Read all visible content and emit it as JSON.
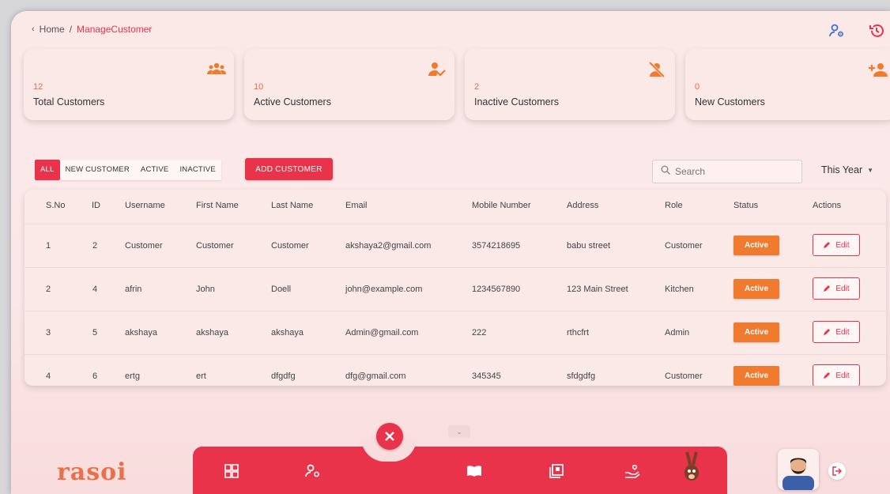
{
  "breadcrumb": {
    "back_icon": "chevron-left-icon",
    "home": "Home",
    "separator": "/",
    "current": "ManageCustomer"
  },
  "header_icons": [
    "user-settings-icon",
    "history-icon"
  ],
  "stats": [
    {
      "value": "12",
      "label": "Total Customers",
      "icon": "group-icon"
    },
    {
      "value": "10",
      "label": "Active Customers",
      "icon": "user-check-icon"
    },
    {
      "value": "2",
      "label": "Inactive Customers",
      "icon": "user-off-icon"
    },
    {
      "value": "0",
      "label": "New Customers",
      "icon": "user-add-icon"
    }
  ],
  "filters": {
    "all": "ALL",
    "new": "NEW CUSTOMER",
    "active": "ACTIVE",
    "inactive": "INACTIVE"
  },
  "add_button": "ADD CUSTOMER",
  "search": {
    "placeholder": "Search"
  },
  "period": {
    "selected": "This Year"
  },
  "table": {
    "headers": {
      "sno": "S.No",
      "id": "ID",
      "username": "Username",
      "first": "First Name",
      "last": "Last Name",
      "email": "Email",
      "mobile": "Mobile Number",
      "address": "Address",
      "role": "Role",
      "status": "Status",
      "actions": "Actions"
    },
    "rows": [
      {
        "sno": "1",
        "id": "2",
        "username": "Customer",
        "first": "Customer",
        "last": "Customer",
        "email": "akshaya2@gmail.com",
        "mobile": "3574218695",
        "address": "babu street",
        "role": "Customer",
        "status": "Active",
        "action": "Edit"
      },
      {
        "sno": "2",
        "id": "4",
        "username": "afrin",
        "first": "John",
        "last": "Doell",
        "email": "john@example.com",
        "mobile": "1234567890",
        "address": "123 Main Street",
        "role": "Kitchen",
        "status": "Active",
        "action": "Edit"
      },
      {
        "sno": "3",
        "id": "5",
        "username": "akshaya",
        "first": "akshaya",
        "last": "akshaya",
        "email": "Admin@gmail.com",
        "mobile": "222",
        "address": "rthcfrt",
        "role": "Admin",
        "status": "Active",
        "action": "Edit"
      },
      {
        "sno": "4",
        "id": "6",
        "username": "ertg",
        "first": "ert",
        "last": "dfgdfg",
        "email": "dfg@gmail.com",
        "mobile": "345345",
        "address": "sfdgdfg",
        "role": "Customer",
        "status": "Active",
        "action": "Edit"
      }
    ]
  },
  "footer": {
    "logo": "rasoi"
  },
  "colors": {
    "accent": "#e8334a",
    "status": "#f07a2e",
    "stat_value": "#f06a3a"
  }
}
